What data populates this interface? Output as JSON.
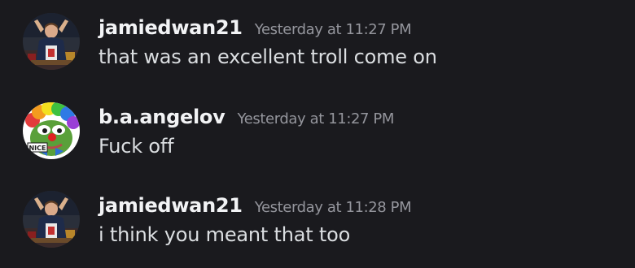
{
  "messages": [
    {
      "username": "jamiedwan21",
      "timestamp": "Yesterday at 11:27 PM",
      "content": "that was an excellent troll come on",
      "avatar_icon": "trophy-photo-avatar"
    },
    {
      "username": "b.a.angelov",
      "timestamp": "Yesterday at 11:27 PM",
      "content": "Fuck off",
      "avatar_icon": "clown-frog-avatar",
      "avatar_badge": "NICE"
    },
    {
      "username": "jamiedwan21",
      "timestamp": "Yesterday at 11:28 PM",
      "content": "i think you meant that too",
      "avatar_icon": "trophy-photo-avatar"
    }
  ],
  "colors": {
    "background": "#1a1a1e",
    "username": "#f2f3f5",
    "timestamp": "#94959c",
    "content": "#dbdee1"
  }
}
